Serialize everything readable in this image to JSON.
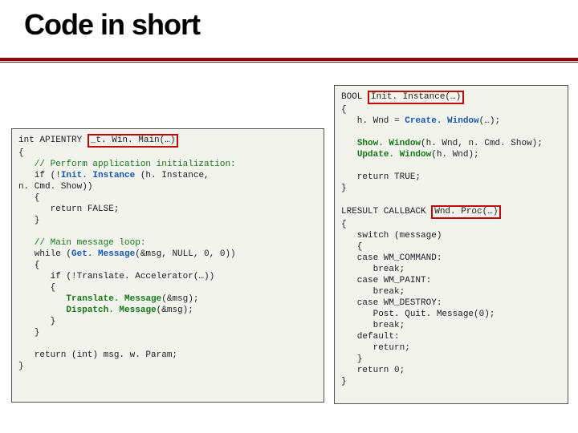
{
  "title": "Code in short",
  "left": {
    "sig_pre": "int APIENTRY ",
    "sig_fn": "_t. Win. Main(…)",
    "l2": "{",
    "c1": "   // Perform application initialization:",
    "l3a": "   if (!",
    "l3b": "Init. Instance",
    "l3c": " (h. Instance,",
    "l4": "n. Cmd. Show))",
    "l5": "   {",
    "l6": "      return FALSE;",
    "l7": "   }",
    "c2": "   // Main message loop:",
    "l8a": "   while (",
    "l8b": "Get. Message",
    "l8c": "(&msg, NULL, 0, 0))",
    "l9": "   {",
    "l10": "      if (!Translate. Accelerator(…))",
    "l11": "      {",
    "l12a": "         ",
    "l12b": "Translate. Message",
    "l12c": "(&msg);",
    "l13a": "         ",
    "l13b": "Dispatch. Message",
    "l13c": "(&msg);",
    "l14": "      }",
    "l15": "   }",
    "l16": "   return (int) msg. w. Param;",
    "l17": "}"
  },
  "right": {
    "t1a": "BOOL ",
    "t1b": "Init. Instance(…)",
    "t2": "{",
    "t3a": "   h. Wnd = ",
    "t3b": "Create. Window",
    "t3c": "(…);",
    "t4a": "   ",
    "t4b": "Show. Window",
    "t4c": "(h. Wnd, n. Cmd. Show);",
    "t5a": "   ",
    "t5b": "Update. Window",
    "t5c": "(h. Wnd);",
    "t6": "   return TRUE;",
    "t7": "}",
    "t8a": "LRESULT CALLBACK ",
    "t8b": "Wnd. Proc(…)",
    "t9": "{",
    "t10": "   switch (message)",
    "t11": "   {",
    "t12": "   case WM_COMMAND:",
    "t13": "      break;",
    "t14": "   case WM_PAINT:",
    "t15": "      break;",
    "t16": "   case WM_DESTROY:",
    "t17": "      Post. Quit. Message(0);",
    "t18": "      break;",
    "t19": "   default:",
    "t20": "      return;",
    "t21": "   }",
    "t22": "   return 0;",
    "t23": "}"
  }
}
